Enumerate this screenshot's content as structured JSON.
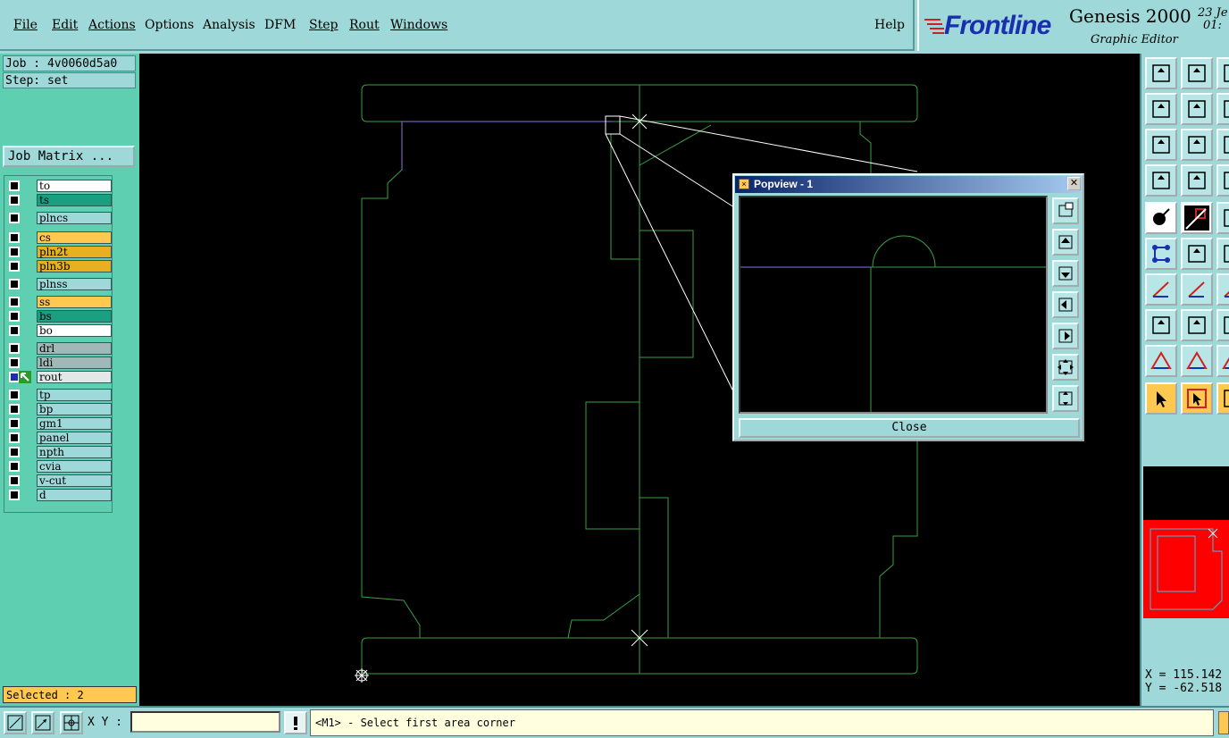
{
  "menubar": {
    "items": [
      "File",
      "Edit",
      "Actions",
      "Options",
      "Analysis",
      "DFM",
      "Step",
      "Rout",
      "Windows"
    ],
    "help": "Help"
  },
  "brand": {
    "logo": "Frontline",
    "product": "Genesis 2000",
    "subtitle": "Graphic Editor",
    "date_line1": "23 Je",
    "date_line2": "01:"
  },
  "left": {
    "job": "Job : 4v0060d5a0",
    "step": "Step: set",
    "job_matrix": "Job Matrix ...",
    "selected": "Selected : 2",
    "layers": [
      {
        "name": "to",
        "color": "#ffffff"
      },
      {
        "name": "ts",
        "color": "#1aa080"
      },
      {
        "name": "plncs",
        "color": "#9fd8d8"
      },
      {
        "name": "cs",
        "color": "#ffc850"
      },
      {
        "name": "pln2t",
        "color": "#e8b020"
      },
      {
        "name": "pln3b",
        "color": "#e8b020"
      },
      {
        "name": "plnss",
        "color": "#9fd8d8"
      },
      {
        "name": "ss",
        "color": "#ffc850"
      },
      {
        "name": "bs",
        "color": "#1aa080"
      },
      {
        "name": "bo",
        "color": "#ffffff"
      },
      {
        "name": "drl",
        "color": "#a0b8b8"
      },
      {
        "name": "ldi",
        "color": "#a0b8b8"
      },
      {
        "name": "rout",
        "color": "#e0e8e8"
      },
      {
        "name": "tp",
        "color": "#9fd8d8"
      },
      {
        "name": "bp",
        "color": "#9fd8d8"
      },
      {
        "name": "gm1",
        "color": "#9fd8d8"
      },
      {
        "name": "panel",
        "color": "#9fd8d8"
      },
      {
        "name": "npth",
        "color": "#9fd8d8"
      },
      {
        "name": "cvia",
        "color": "#9fd8d8"
      },
      {
        "name": "v-cut",
        "color": "#9fd8d8"
      },
      {
        "name": "d",
        "color": "#9fd8d8"
      }
    ]
  },
  "popview": {
    "title": "Popview - 1",
    "close": "Close"
  },
  "coords": {
    "x": "X = 115.142",
    "y": "Y = -62.518"
  },
  "status": {
    "xy_label": "X Y :",
    "xy_value": "",
    "message": "<M1> - Select first area corner"
  },
  "colors": {
    "outline": "#3aa040",
    "highlight": "#9070e0",
    "panel": "#5ecfb0",
    "chrome": "#9fd8d8"
  }
}
